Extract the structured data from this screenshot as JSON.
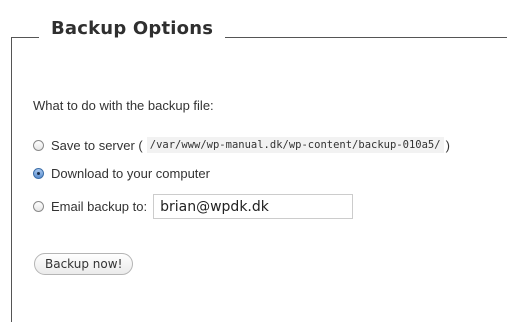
{
  "section": {
    "title": "Backup Options"
  },
  "form": {
    "prompt": "What to do with the backup file:",
    "options": [
      {
        "label": "Save to server (",
        "path": "/var/www/wp-manual.dk/wp-content/backup-010a5/",
        "suffix": ")",
        "selected": false
      },
      {
        "label": "Download to your computer",
        "selected": true
      },
      {
        "label": "Email backup to:",
        "selected": false
      }
    ],
    "email_value": "brian@wpdk.dk",
    "submit_label": "Backup now!"
  }
}
